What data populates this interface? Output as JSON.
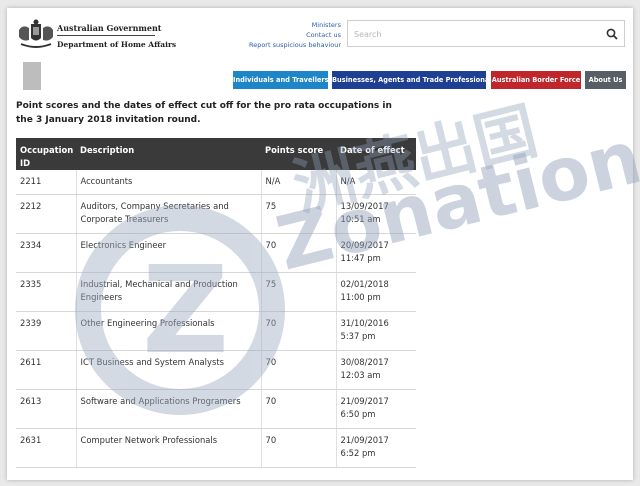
{
  "header": {
    "gov_name": "Australian Government",
    "department": "Department of Home Affairs",
    "util_links": [
      "Ministers",
      "Contact us",
      "Report suspicious behaviour"
    ],
    "search_placeholder": "Search"
  },
  "nav": [
    {
      "label": "Individuals and Travellers",
      "color": "#1e86c8"
    },
    {
      "label": "Businesses, Agents and Trade Professionals",
      "color": "#1f3f93"
    },
    {
      "label": "Australian Border Force",
      "color": "#c0272d"
    },
    {
      "label": "About Us",
      "color": "#565f66"
    }
  ],
  "intro": "Point scores and the dates of effect cut off for the pro rata occupations in the 3 January 2018 invitation round.",
  "table": {
    "headers": [
      "Occupation ID",
      "Description",
      "Points score",
      "Date of effect"
    ],
    "rows": [
      {
        "id": "2211",
        "desc": "Accountants",
        "points": "N/A",
        "date": "N/A",
        "time": ""
      },
      {
        "id": "2212",
        "desc": "Auditors, Company Secretaries and Corporate Treasurers",
        "points": "75",
        "date": "13/09/2017",
        "time": "10:51 am"
      },
      {
        "id": "2334",
        "desc": "Electronics Engineer",
        "points": "70",
        "date": "20/09/2017",
        "time": "11:47 pm"
      },
      {
        "id": "2335",
        "desc": "Industrial, Mechanical and Production Engineers",
        "points": "75",
        "date": "02/01/2018",
        "time": "11:00 pm"
      },
      {
        "id": "2339",
        "desc": "Other Engineering Professionals",
        "points": "70",
        "date": "31/10/2016",
        "time": "5:37 pm"
      },
      {
        "id": "2611",
        "desc": "ICT Business and System Analysts",
        "points": "70",
        "date": "30/08/2017",
        "time": "12:03 am"
      },
      {
        "id": "2613",
        "desc": "Software and Applications Programers",
        "points": "70",
        "date": "21/09/2017",
        "time": "6:50 pm"
      },
      {
        "id": "2631",
        "desc": "Computer Network Professionals",
        "points": "70",
        "date": "21/09/2017",
        "time": "6:52 pm"
      }
    ]
  },
  "watermark": {
    "cn": "洲燕出国",
    "en": "Zonation",
    "color": "#8fa0b8"
  }
}
